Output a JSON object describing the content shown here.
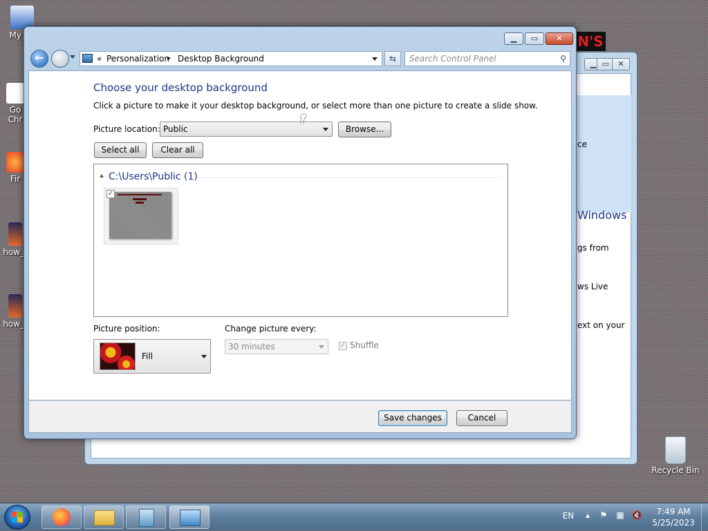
{
  "desktop": {
    "icons": [
      {
        "label": "My Co"
      },
      {
        "label": "Go\nChr"
      },
      {
        "label": "Fir"
      },
      {
        "label": "how_t"
      },
      {
        "label": "how_t"
      },
      {
        "label": "Recycle Bin"
      }
    ],
    "banner_text": "N'S"
  },
  "background_window": {
    "text_lines": [
      "ce",
      "Windows",
      "gs from",
      "ws Live",
      "ext on your"
    ]
  },
  "window": {
    "breadcrumb": {
      "item1": "Personalization",
      "separator": "▸",
      "item2": "Desktop Background"
    },
    "search_placeholder": "Search Control Panel",
    "caption_buttons": {
      "minimize": "▁",
      "maximize": "▭",
      "close": "✕"
    }
  },
  "content": {
    "title": "Choose your desktop background",
    "description": "Click a picture to make it your desktop background, or select more than one picture to create a slide show.",
    "picture_location_label": "Picture location:",
    "picture_location_value": "Public",
    "browse_label": "Browse...",
    "select_all_label": "Select all",
    "clear_all_label": "Clear all",
    "group_label": "C:\\Users\\Public (1)",
    "thumbnail_checked": true,
    "picture_position_label": "Picture position:",
    "picture_position_value": "Fill",
    "change_picture_label": "Change picture every:",
    "change_picture_value": "30 minutes",
    "shuffle_label": "Shuffle"
  },
  "footer": {
    "save_label": "Save changes",
    "cancel_label": "Cancel"
  },
  "taskbar": {
    "lang": "EN",
    "time": "7:49 AM",
    "date": "5/25/2023"
  },
  "colors": {
    "heading": "#1e3287",
    "link_group": "#1e3287",
    "taskbar": "#5f7f9f"
  }
}
